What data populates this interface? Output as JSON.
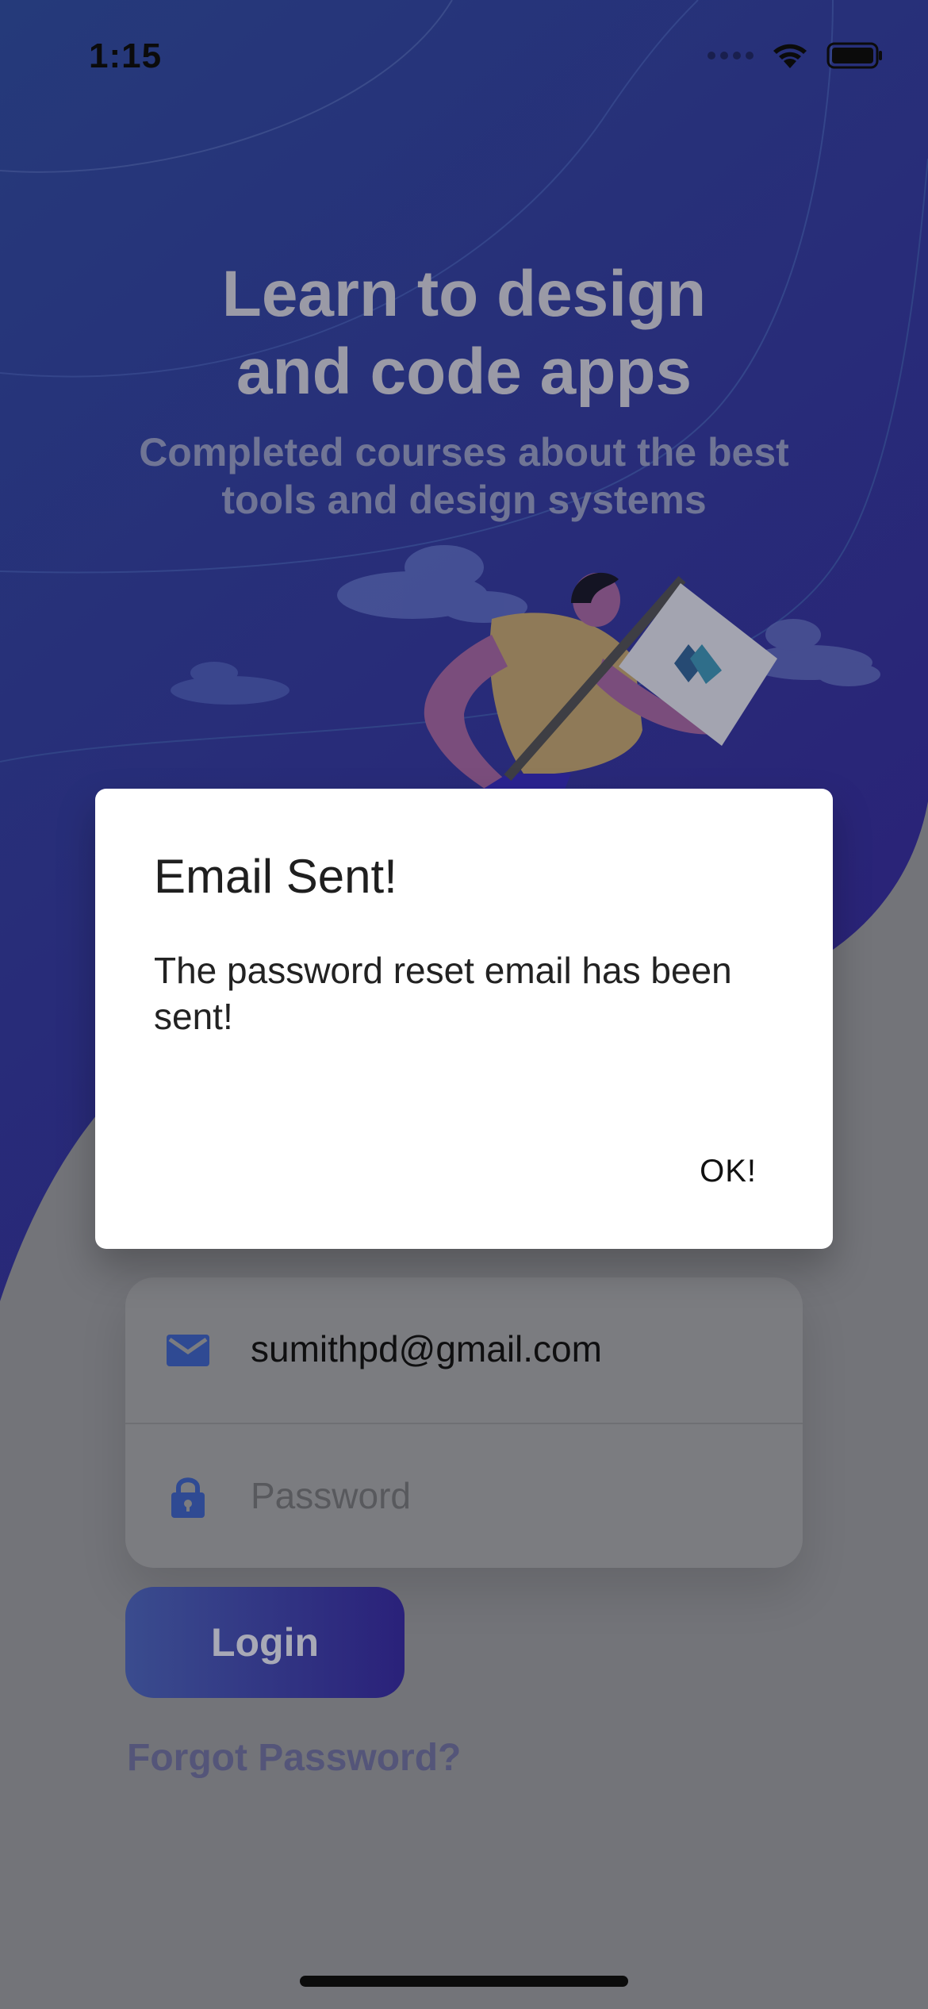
{
  "status_bar": {
    "time": "1:15",
    "icons": [
      "signal-icon",
      "wifi-icon",
      "battery-icon"
    ]
  },
  "hero": {
    "title_line1": "Learn to design",
    "title_line2": "and code apps",
    "subtitle_line1": "Completed courses about the best",
    "subtitle_line2": "tools and design systems"
  },
  "form": {
    "email": {
      "icon": "mail-icon",
      "value": "sumithpd@gmail.com"
    },
    "password": {
      "icon": "lock-icon",
      "placeholder": "Password"
    },
    "login_label": "Login",
    "forgot_label": "Forgot Password?"
  },
  "dialog": {
    "title": "Email Sent!",
    "body": "The password reset email has been sent!",
    "ok_label": "OK!"
  },
  "colors": {
    "hero_gradient_top": "#3b4f9a",
    "hero_gradient_bottom": "#2d237e",
    "overlay": "#6f7074",
    "brand_accent": "#3d55a0"
  }
}
